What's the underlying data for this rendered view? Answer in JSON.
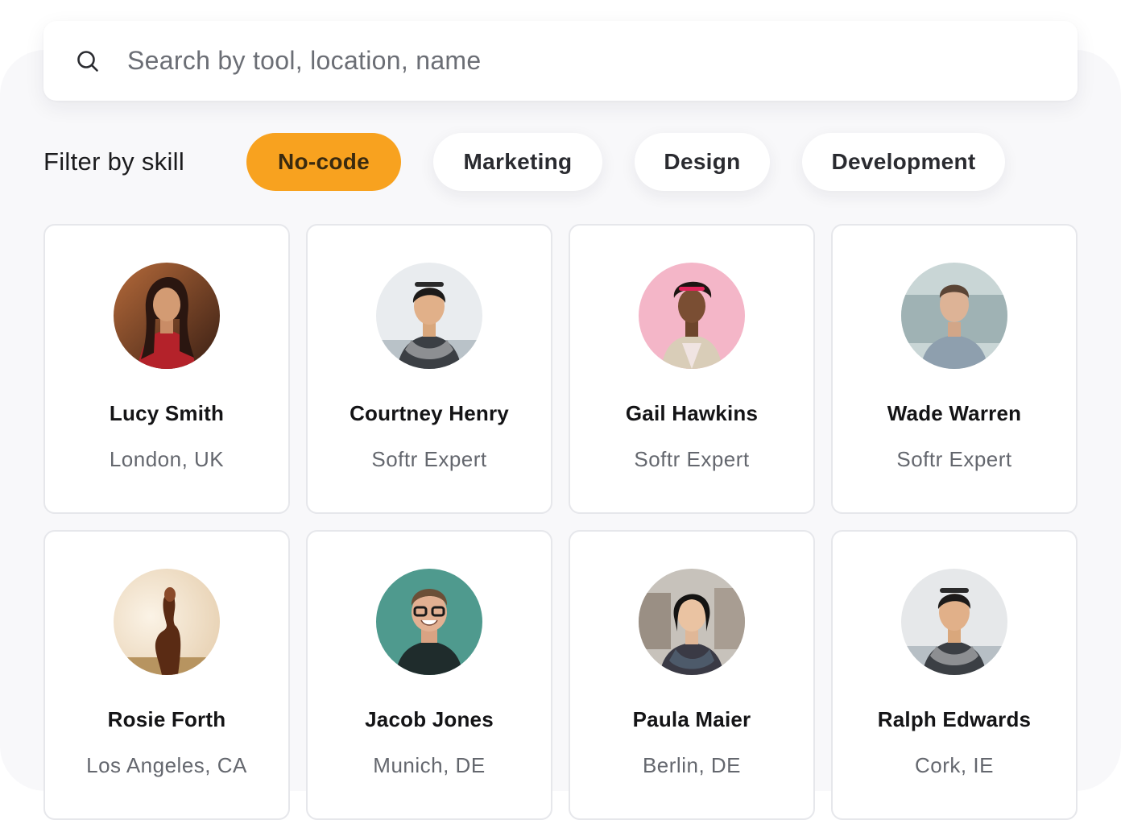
{
  "search": {
    "placeholder": "Search by tool, location, name",
    "icon": "search-icon"
  },
  "filters": {
    "label": "Filter by skill",
    "active_color": "#F8A21F",
    "items": [
      {
        "label": "No-code",
        "active": true
      },
      {
        "label": "Marketing",
        "active": false
      },
      {
        "label": "Design",
        "active": false
      },
      {
        "label": "Development",
        "active": false
      }
    ]
  },
  "people": [
    {
      "name": "Lucy Smith",
      "subtitle": "London, UK",
      "avatar": "avatar-photo"
    },
    {
      "name": "Courtney Henry",
      "subtitle": "Softr Expert",
      "avatar": "avatar-photo"
    },
    {
      "name": "Gail Hawkins",
      "subtitle": "Softr Expert",
      "avatar": "avatar-photo"
    },
    {
      "name": "Wade Warren",
      "subtitle": "Softr Expert",
      "avatar": "avatar-photo"
    },
    {
      "name": "Rosie Forth",
      "subtitle": "Los Angeles, CA",
      "avatar": "avatar-photo"
    },
    {
      "name": "Jacob Jones",
      "subtitle": "Munich, DE",
      "avatar": "avatar-photo"
    },
    {
      "name": "Paula Maier",
      "subtitle": "Berlin, DE",
      "avatar": "avatar-photo"
    },
    {
      "name": "Ralph Edwards",
      "subtitle": "Cork, IE",
      "avatar": "avatar-photo"
    }
  ]
}
